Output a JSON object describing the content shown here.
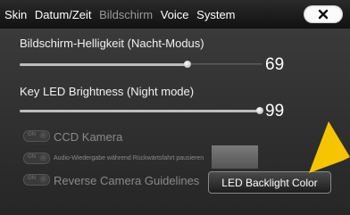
{
  "tabs": [
    {
      "label": "Skin",
      "active": false
    },
    {
      "label": "Datum/Zeit",
      "active": false
    },
    {
      "label": "Bildschirm",
      "active": true
    },
    {
      "label": "Voice",
      "active": false
    },
    {
      "label": "System",
      "active": false
    }
  ],
  "close_icon": "close-x-icon",
  "brightness_night": {
    "label": "Bildschirm-Helligkeit (Nacht-Modus)",
    "value": "69",
    "level_percent": 69
  },
  "key_led_night": {
    "label": "Key LED Brightness (Night mode)",
    "value": "99",
    "level_percent": 99
  },
  "toggles": [
    {
      "on_text": "ON",
      "label": "CCD Kamera"
    },
    {
      "on_text": "ON",
      "label": "Audio-Wiedergabe während Rückwärtsfahrt pausieren"
    },
    {
      "on_text": "ON",
      "label": "Reverse Camera Guidelines"
    }
  ],
  "led_backlight_button": "LED Backlight Color",
  "colors": {
    "accent_arrow": "#f6c400",
    "disabled_text": "#8a8a8a"
  }
}
